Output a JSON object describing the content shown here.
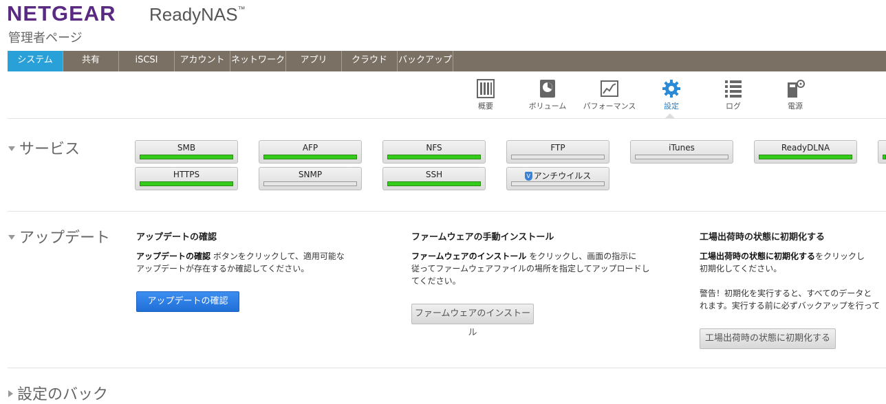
{
  "header": {
    "brand": "NETGEAR",
    "product": "ReadyNAS",
    "trademark": "™",
    "subtitle": "管理者ページ"
  },
  "nav": {
    "tabs": [
      {
        "label": "システム",
        "active": true
      },
      {
        "label": "共有"
      },
      {
        "label": "iSCSI"
      },
      {
        "label": "アカウント"
      },
      {
        "label": "ネットワーク"
      },
      {
        "label": "アプリ"
      },
      {
        "label": "クラウド"
      },
      {
        "label": "バックアップ"
      }
    ]
  },
  "subnav": {
    "items": [
      {
        "label": "概要",
        "icon": "overview-icon"
      },
      {
        "label": "ボリューム",
        "icon": "volume-icon"
      },
      {
        "label": "パフォーマンス",
        "icon": "performance-icon"
      },
      {
        "label": "設定",
        "icon": "gear-icon",
        "active": true
      },
      {
        "label": "ログ",
        "icon": "list-icon"
      },
      {
        "label": "電源",
        "icon": "power-icon"
      }
    ]
  },
  "services": {
    "title": "サービス",
    "items": [
      {
        "label": "SMB",
        "enabled": true
      },
      {
        "label": "AFP",
        "enabled": true
      },
      {
        "label": "NFS",
        "enabled": true
      },
      {
        "label": "FTP",
        "enabled": false
      },
      {
        "label": "iTunes",
        "enabled": false
      },
      {
        "label": "ReadyDLNA",
        "enabled": true
      },
      {
        "label": "HTTPS",
        "enabled": true
      },
      {
        "label": "SNMP",
        "enabled": false
      },
      {
        "label": "SSH",
        "enabled": true
      },
      {
        "label": "アンチウイルス",
        "enabled": false,
        "icon": "shield-icon"
      }
    ]
  },
  "update": {
    "title": "アップデート",
    "check": {
      "heading": "アップデートの確認",
      "text_bold": "アップデートの確認",
      "text_line1": " ボタンをクリックして、適用可能な",
      "text_line2": "アップデートが存在するか確認してください。",
      "button": "アップデートの確認"
    },
    "manual": {
      "heading": "ファームウェアの手動インストール",
      "text_bold": "ファームウェアのインストール",
      "text_line1": " をクリックし、画面の指示に",
      "text_line2": "従ってファームウェアファイルの場所を指定してアップロードし",
      "text_line3": "てください。",
      "button": "ファームウェアのインストール"
    },
    "factory": {
      "heading": "工場出荷時の状態に初期化する",
      "text_bold": "工場出荷時の状態に初期化する",
      "text_line1": "をクリックし",
      "text_line2": "初期化してください。",
      "warning_line1": "警告！初期化を実行すると、すべてのデータと",
      "warning_line2": "れます。実行する前に必ずバックアップを行って",
      "button": "工場出荷時の状態に初期化する"
    }
  },
  "backup_section": {
    "title": "設定のバック"
  }
}
